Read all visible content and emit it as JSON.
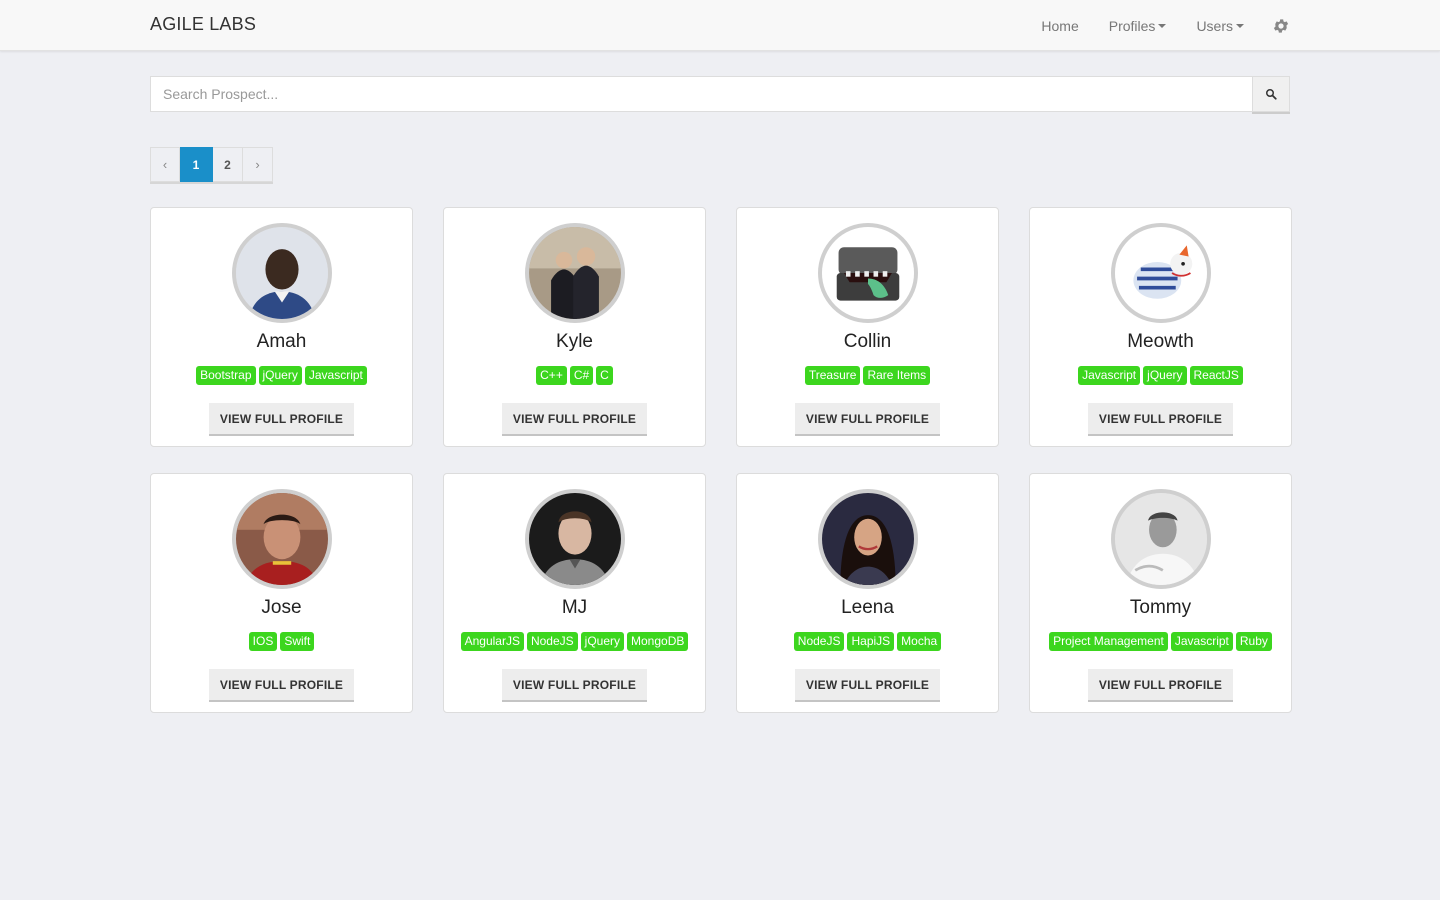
{
  "navbar": {
    "brand": "AGILE LABS",
    "links": [
      {
        "label": "Home",
        "dropdown": false
      },
      {
        "label": "Profiles",
        "dropdown": true
      },
      {
        "label": "Users",
        "dropdown": true
      }
    ],
    "settings_icon": "gear-icon"
  },
  "search": {
    "placeholder": "Search Prospect...",
    "value": "",
    "button_icon": "search-icon"
  },
  "pagination": {
    "prev": "‹",
    "pages": [
      "1",
      "2"
    ],
    "active": "1",
    "next": "›"
  },
  "profiles": [
    {
      "name": "Amah",
      "tags": [
        "Bootstrap",
        "jQuery",
        "Javascript"
      ],
      "button": "VIEW FULL PROFILE"
    },
    {
      "name": "Kyle",
      "tags": [
        "C++",
        "C#",
        "C"
      ],
      "button": "VIEW FULL PROFILE"
    },
    {
      "name": "Collin",
      "tags": [
        "Treasure",
        "Rare Items"
      ],
      "button": "VIEW FULL PROFILE"
    },
    {
      "name": "Meowth",
      "tags": [
        "Javascript",
        "jQuery",
        "ReactJS"
      ],
      "button": "VIEW FULL PROFILE"
    },
    {
      "name": "Jose",
      "tags": [
        "IOS",
        "Swift"
      ],
      "button": "VIEW FULL PROFILE"
    },
    {
      "name": "MJ",
      "tags": [
        "AngularJS",
        "NodeJS",
        "jQuery",
        "MongoDB"
      ],
      "button": "VIEW FULL PROFILE"
    },
    {
      "name": "Leena",
      "tags": [
        "NodeJS",
        "HapiJS",
        "Mocha"
      ],
      "button": "VIEW FULL PROFILE"
    },
    {
      "name": "Tommy",
      "tags": [
        "Project Management",
        "Javascript",
        "Ruby"
      ],
      "button": "VIEW FULL PROFILE"
    }
  ],
  "colors": {
    "accent": "#1a8fc9",
    "tag": "#3cd61e",
    "background": "#eeeff3"
  }
}
